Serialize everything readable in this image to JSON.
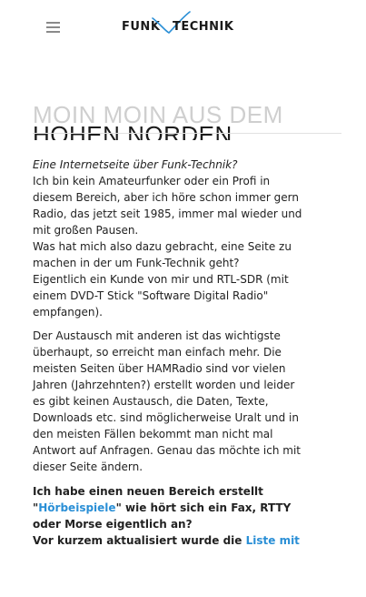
{
  "header": {
    "logo_left": "FUNK",
    "logo_right": "TECHNIK",
    "menu_icon": "hamburger-icon",
    "accent_color": "#2a8fd6"
  },
  "hero": {
    "ghost_title": "MOIN MOIN AUS DEM",
    "title": "HOHEN NORDEN"
  },
  "content": {
    "lead_italic": "Eine Internetseite über Funk-Technik?",
    "para1_line1": "Ich bin kein Amateurfunker oder ein Profi in",
    "para1_line2": "diesem Bereich, aber ich höre schon immer gern",
    "para1_line3": "Radio, das jetzt seit 1985, immer mal wieder und",
    "para1_line4": "mit großen Pausen.",
    "para1_line5": "Was hat mich also dazu gebracht, eine Seite zu",
    "para1_line6": "machen in der um Funk-Technik geht?",
    "para1_line7": "Eigentlich ein Kunde von mir und RTL-SDR (mit",
    "para1_line8": "einem DVD-T Stick \"Software Digital Radio\"",
    "para1_line9": "empfangen).",
    "para2_line1": "Der Austausch mit anderen ist das wichtigste",
    "para2_line2": "überhaupt, so erreicht man einfach mehr. Die",
    "para2_line3": "meisten Seiten über HAMRadio sind vor vielen",
    "para2_line4": "Jahren (Jahrzehnten?) erstellt worden und leider",
    "para2_line5": "es gibt keinen Austausch, die Daten, Texte,",
    "para2_line6": "Downloads etc. sind möglicherweise Uralt und in",
    "para2_line7": "den meisten Fällen bekommt man nicht mal",
    "para2_line8": "Antwort auf Anfragen. Genau das möchte ich mit",
    "para2_line9": "dieser Seite ändern.",
    "para3_line1": "Ich habe einen neuen Bereich erstellt",
    "para3_quote_open": "\"",
    "para3_link": "Hörbeispiele",
    "para3_quote_close": "\"",
    "para3_line2_rest": " wie hört sich ein Fax, RTTY",
    "para3_line3": "oder Morse eigentlich an?",
    "para4_text": "Vor kurzem aktualisiert wurde die ",
    "para4_link": "Liste mit"
  }
}
